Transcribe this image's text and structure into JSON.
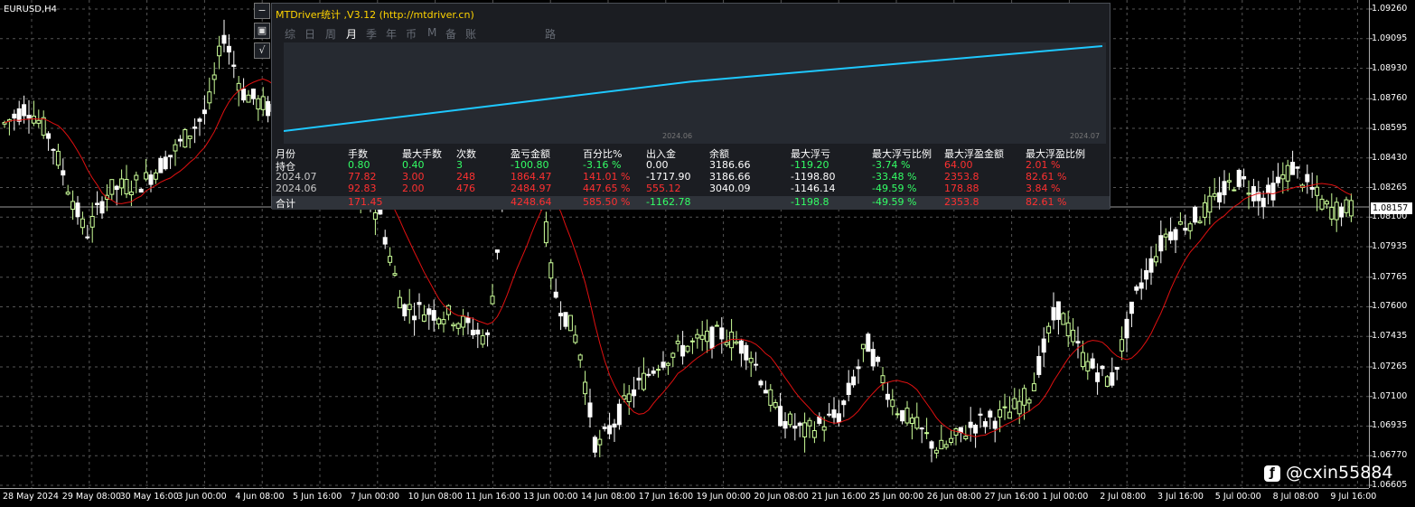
{
  "chart": {
    "symbol": "EURUSD,H4",
    "current_price": "1.08157",
    "y_axis": [
      "1.09260",
      "1.09095",
      "1.08930",
      "1.08760",
      "1.08595",
      "1.08430",
      "1.08265",
      "1.08100",
      "1.07935",
      "1.07765",
      "1.07600",
      "1.07435",
      "1.07265",
      "1.07100",
      "1.06935",
      "1.06770",
      "1.06605"
    ],
    "x_axis": [
      "28 May 2024",
      "29 May 08:00",
      "30 May 16:00",
      "3 Jun 00:00",
      "4 Jun 08:00",
      "5 Jun 16:00",
      "7 Jun 00:00",
      "10 Jun 08:00",
      "11 Jun 16:00",
      "13 Jun 00:00",
      "14 Jun 08:00",
      "17 Jun 16:00",
      "19 Jun 00:00",
      "20 Jun 08:00",
      "21 Jun 16:00",
      "25 Jun 00:00",
      "26 Jun 08:00",
      "27 Jun 16:00",
      "1 Jul 00:00",
      "2 Jul 08:00",
      "3 Jul 16:00",
      "5 Jul 00:00",
      "8 Jul 08:00",
      "9 Jul 16:00"
    ],
    "colors": {
      "bull": "#ccff99",
      "bear": "#ffffff",
      "ma": "#e01010",
      "grid": "#555555",
      "axis": "#aaaaaa"
    },
    "side_buttons": [
      "−",
      "▣",
      "√"
    ]
  },
  "panel": {
    "title": "MTDriver统计 ,V3.12 (http://mtdriver.cn)",
    "tabs": [
      "综",
      "日",
      "周",
      "月",
      "季",
      "年",
      "币",
      "M",
      "备",
      "账户",
      "路径"
    ],
    "active_tab": "月",
    "mini_labels": [
      "2024.06",
      "2024.07"
    ],
    "mini_series": [
      0,
      1764.47,
      3040.09
    ],
    "headers": [
      "月份",
      "手数",
      "最大手数",
      "次数",
      "盈亏金额",
      "百分比%",
      "出入金",
      "余额",
      "最大浮亏",
      "最大浮亏比例",
      "最大浮盈金额",
      "最大浮盈比例"
    ],
    "rows": [
      [
        "持仓",
        "0.80",
        "0.40",
        "3",
        "-100.80",
        "-3.16 %",
        "0.00",
        "3186.66",
        "-119.20",
        "-3.74 %",
        "64.00",
        "2.01 %"
      ],
      [
        "2024.07",
        "77.82",
        "3.00",
        "248",
        "1864.47",
        "141.01 %",
        "-1717.90",
        "3186.66",
        "-1198.80",
        "-33.48 %",
        "2353.8",
        "82.61 %"
      ],
      [
        "2024.06",
        "92.83",
        "2.00",
        "476",
        "2484.97",
        "447.65 %",
        "555.12",
        "3040.09",
        "-1146.14",
        "-49.59 %",
        "178.88",
        "3.84 %"
      ]
    ],
    "total": [
      "合计",
      "171.45",
      "",
      "",
      "4248.64",
      "585.50 %",
      "-1162.78",
      "",
      "-1198.8",
      "-49.59 %",
      "2353.8",
      "82.61 %"
    ]
  },
  "watermark": "@cxin55884"
}
